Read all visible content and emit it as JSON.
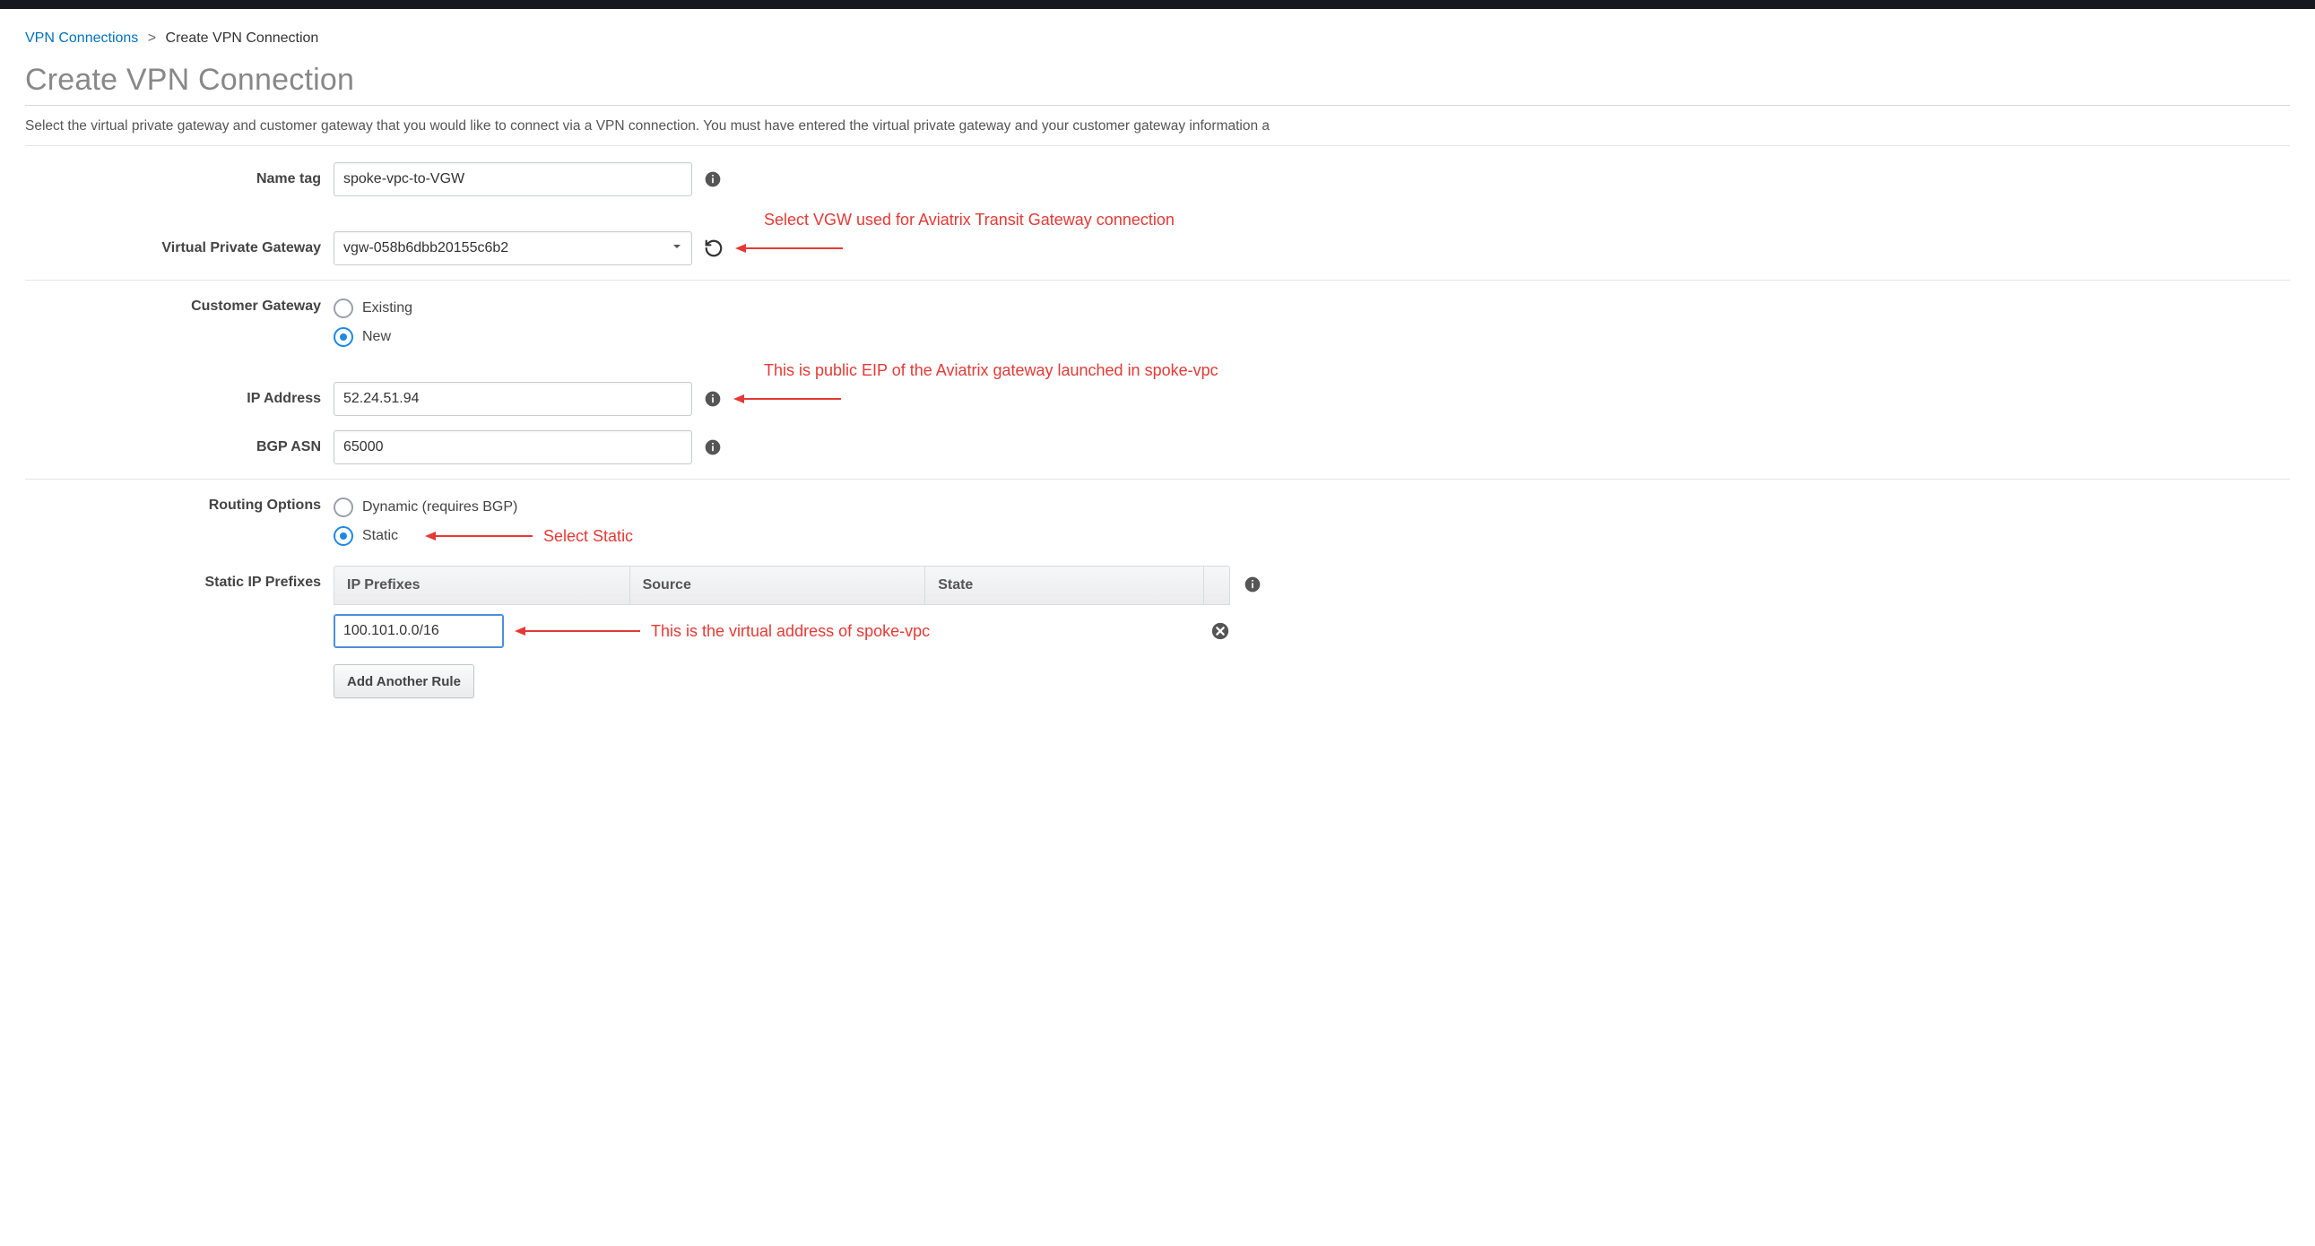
{
  "breadcrumb": {
    "root": "VPN Connections",
    "current": "Create VPN Connection"
  },
  "title": "Create VPN Connection",
  "description": "Select the virtual private gateway and customer gateway that you would like to connect via a VPN connection. You must have entered the virtual private gateway and your customer gateway information a",
  "form": {
    "name_tag": {
      "label": "Name tag",
      "value": "spoke-vpc-to-VGW"
    },
    "vpg": {
      "label": "Virtual Private Gateway",
      "value": "vgw-058b6dbb20155c6b2"
    },
    "cgw": {
      "label": "Customer Gateway",
      "options": {
        "existing": "Existing",
        "new": "New"
      },
      "selected": "new"
    },
    "ip": {
      "label": "IP Address",
      "value": "52.24.51.94"
    },
    "asn": {
      "label": "BGP ASN",
      "value": "65000"
    },
    "routing": {
      "label": "Routing Options",
      "options": {
        "dynamic": "Dynamic (requires BGP)",
        "static": "Static"
      },
      "selected": "static"
    },
    "prefixes": {
      "label": "Static IP Prefixes",
      "headers": {
        "c1": "IP Prefixes",
        "c2": "Source",
        "c3": "State"
      },
      "rows": [
        {
          "value": "100.101.0.0/16"
        }
      ],
      "add_button": "Add Another Rule"
    }
  },
  "annotations": {
    "vgw": "Select VGW used for Aviatrix Transit Gateway connection",
    "ip": "This is public EIP of the Aviatrix gateway launched in spoke-vpc",
    "static": "Select Static",
    "prefix": "This is the virtual address of spoke-vpc"
  }
}
